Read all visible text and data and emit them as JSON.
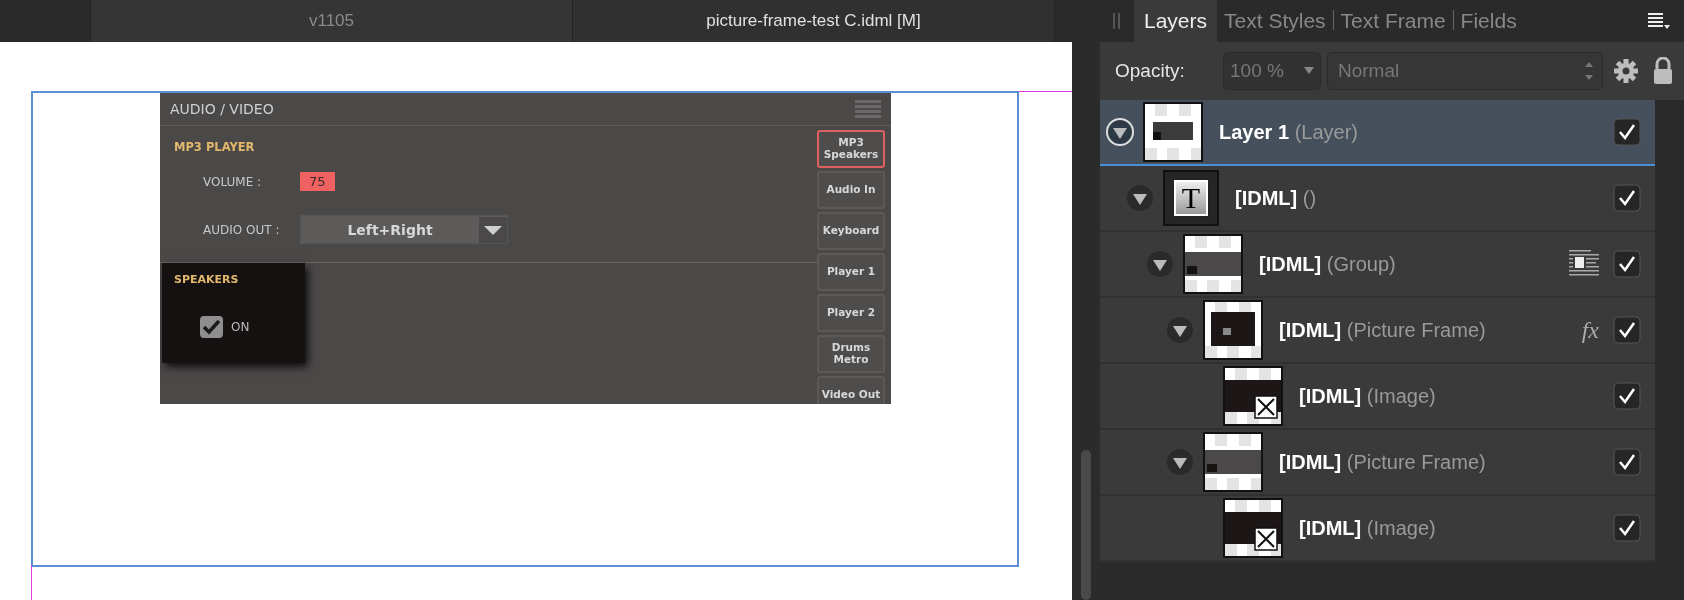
{
  "document_tabs": [
    {
      "label": "v1105",
      "selected": false
    },
    {
      "label": "picture-frame-test C.idml [M]",
      "selected": true
    }
  ],
  "embedded_screen": {
    "title": "AUDIO / VIDEO",
    "section": "MP3 PLAYER",
    "volume": {
      "label": "VOLUME :",
      "value": "75"
    },
    "audio_out": {
      "label": "AUDIO OUT :",
      "value": "Left+Right"
    },
    "speakers": {
      "title": "SPEAKERS",
      "label": "ON",
      "checked": true
    },
    "side_tabs": [
      {
        "label": "MP3 Speakers",
        "selected": true
      },
      {
        "label": "Audio In",
        "selected": false
      },
      {
        "label": "Keyboard",
        "selected": false
      },
      {
        "label": "Player 1",
        "selected": false
      },
      {
        "label": "Player 2",
        "selected": false
      },
      {
        "label": "Drums Metro",
        "selected": false
      },
      {
        "label": "Video Out",
        "selected": false
      }
    ]
  },
  "panel": {
    "tabs": [
      {
        "label": "Layers",
        "selected": true
      },
      {
        "label": "Text Styles",
        "selected": false
      },
      {
        "label": "Text Frame",
        "selected": false
      },
      {
        "label": "Fields",
        "selected": false
      }
    ],
    "opacity": {
      "label": "Opacity:",
      "value": "100 %",
      "blend_mode": "Normal"
    },
    "layers": [
      {
        "name": "Layer 1",
        "type": "(Layer)",
        "kind": "layer",
        "selected": true,
        "expanded": true,
        "visible": true,
        "children": [
          {
            "name": "[IDML]",
            "type": "()",
            "kind": "text",
            "thumb_glyph": "T",
            "selected": false,
            "expanded": true,
            "visible": true,
            "children": [
              {
                "name": "[IDML]",
                "type": "(Group)",
                "kind": "group",
                "text_wrap": true,
                "selected": false,
                "expanded": true,
                "visible": true,
                "children": [
                  {
                    "name": "[IDML]",
                    "type": "(Picture Frame)",
                    "kind": "frame",
                    "effects_label": "fx",
                    "selected": false,
                    "expanded": true,
                    "visible": true,
                    "children": [
                      {
                        "name": "[IDML]",
                        "type": "(Image)",
                        "selected": false,
                        "visible": true
                      }
                    ]
                  },
                  {
                    "name": "[IDML]",
                    "type": "(Picture Frame)",
                    "kind": "frame_group",
                    "selected": false,
                    "expanded": true,
                    "visible": true,
                    "children": [
                      {
                        "name": "[IDML]",
                        "type": "(Image)",
                        "selected": false,
                        "visible": true
                      }
                    ]
                  }
                ]
              }
            ]
          }
        ]
      }
    ]
  }
}
